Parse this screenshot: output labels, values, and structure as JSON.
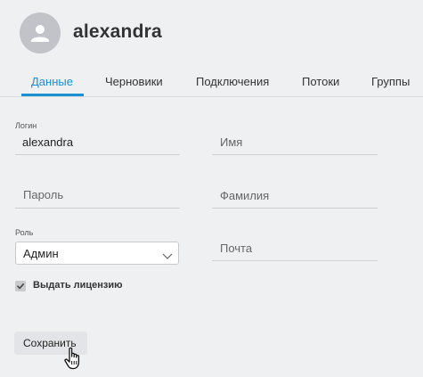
{
  "profile": {
    "username": "alexandra",
    "avatar_icon": "user-icon"
  },
  "tabs": [
    {
      "label": "Данные",
      "active": true
    },
    {
      "label": "Черновики",
      "active": false
    },
    {
      "label": "Подключения",
      "active": false
    },
    {
      "label": "Потоки",
      "active": false
    },
    {
      "label": "Группы",
      "active": false
    }
  ],
  "form": {
    "login": {
      "label": "Логин",
      "value": "alexandra"
    },
    "password": {
      "placeholder": "Пароль"
    },
    "role": {
      "label": "Роль",
      "value": "Админ"
    },
    "first_name": {
      "placeholder": "Имя"
    },
    "last_name": {
      "placeholder": "Фамилия"
    },
    "email": {
      "placeholder": "Почта"
    },
    "license": {
      "label": "Выдать лицензию",
      "checked": true
    },
    "save_label": "Сохранить"
  },
  "colors": {
    "accent": "#1a8fd1",
    "background": "#eff0f2",
    "avatar": "#c1c3c8"
  }
}
